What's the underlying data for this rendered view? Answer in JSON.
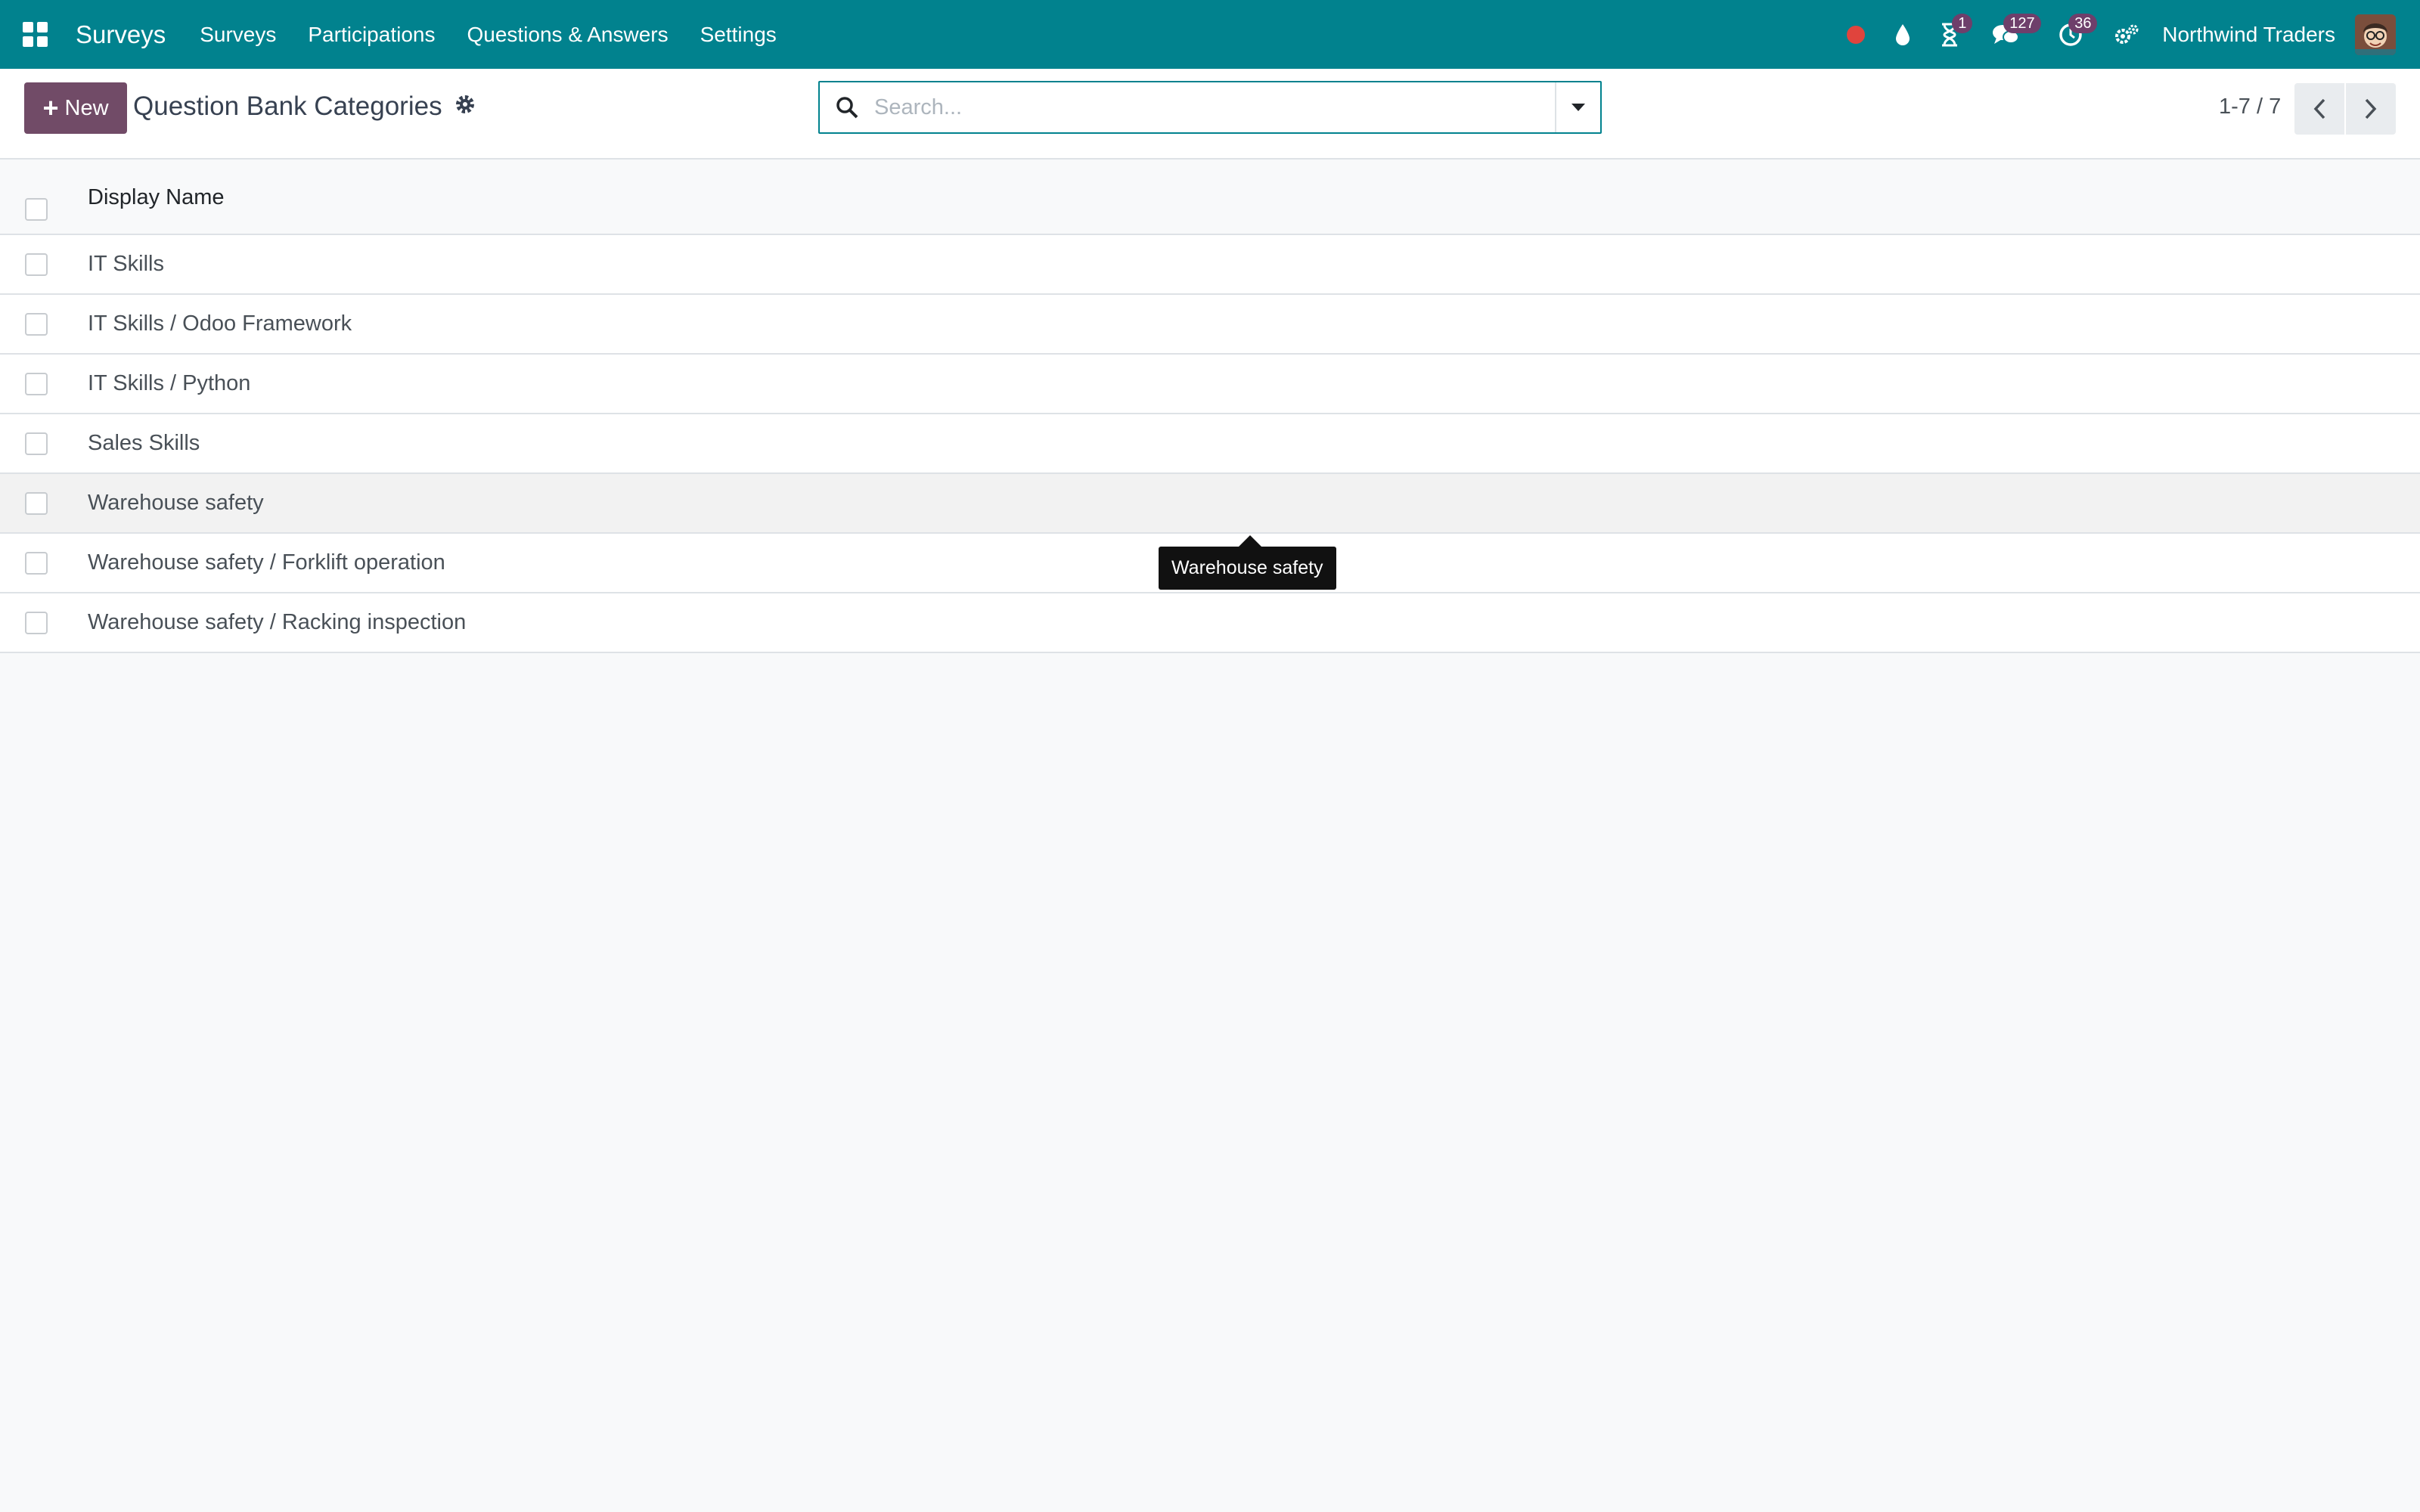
{
  "navbar": {
    "brand": "Surveys",
    "menu": [
      "Surveys",
      "Participations",
      "Questions & Answers",
      "Settings"
    ],
    "icons": {
      "status_dot_color": "#e0443d",
      "activity_badge": "1",
      "messages_badge": "127",
      "clock_badge": "36"
    },
    "company": "Northwind Traders"
  },
  "control_panel": {
    "new_label": "New",
    "title": "Question Bank Categories",
    "search": {
      "placeholder": "Search...",
      "value": ""
    },
    "pager": "1-7 / 7"
  },
  "list": {
    "columns": [
      "Display Name"
    ],
    "rows": [
      "IT Skills",
      "IT Skills / Odoo Framework",
      "IT Skills / Python",
      "Sales Skills",
      "Warehouse safety",
      "Warehouse safety / Forklift operation",
      "Warehouse safety / Racking inspection"
    ]
  },
  "tooltip": {
    "text": "Warehouse safety"
  },
  "colors": {
    "navbar": "#01828e",
    "primary_button": "#714b67",
    "badge": "#6e3f6b"
  }
}
